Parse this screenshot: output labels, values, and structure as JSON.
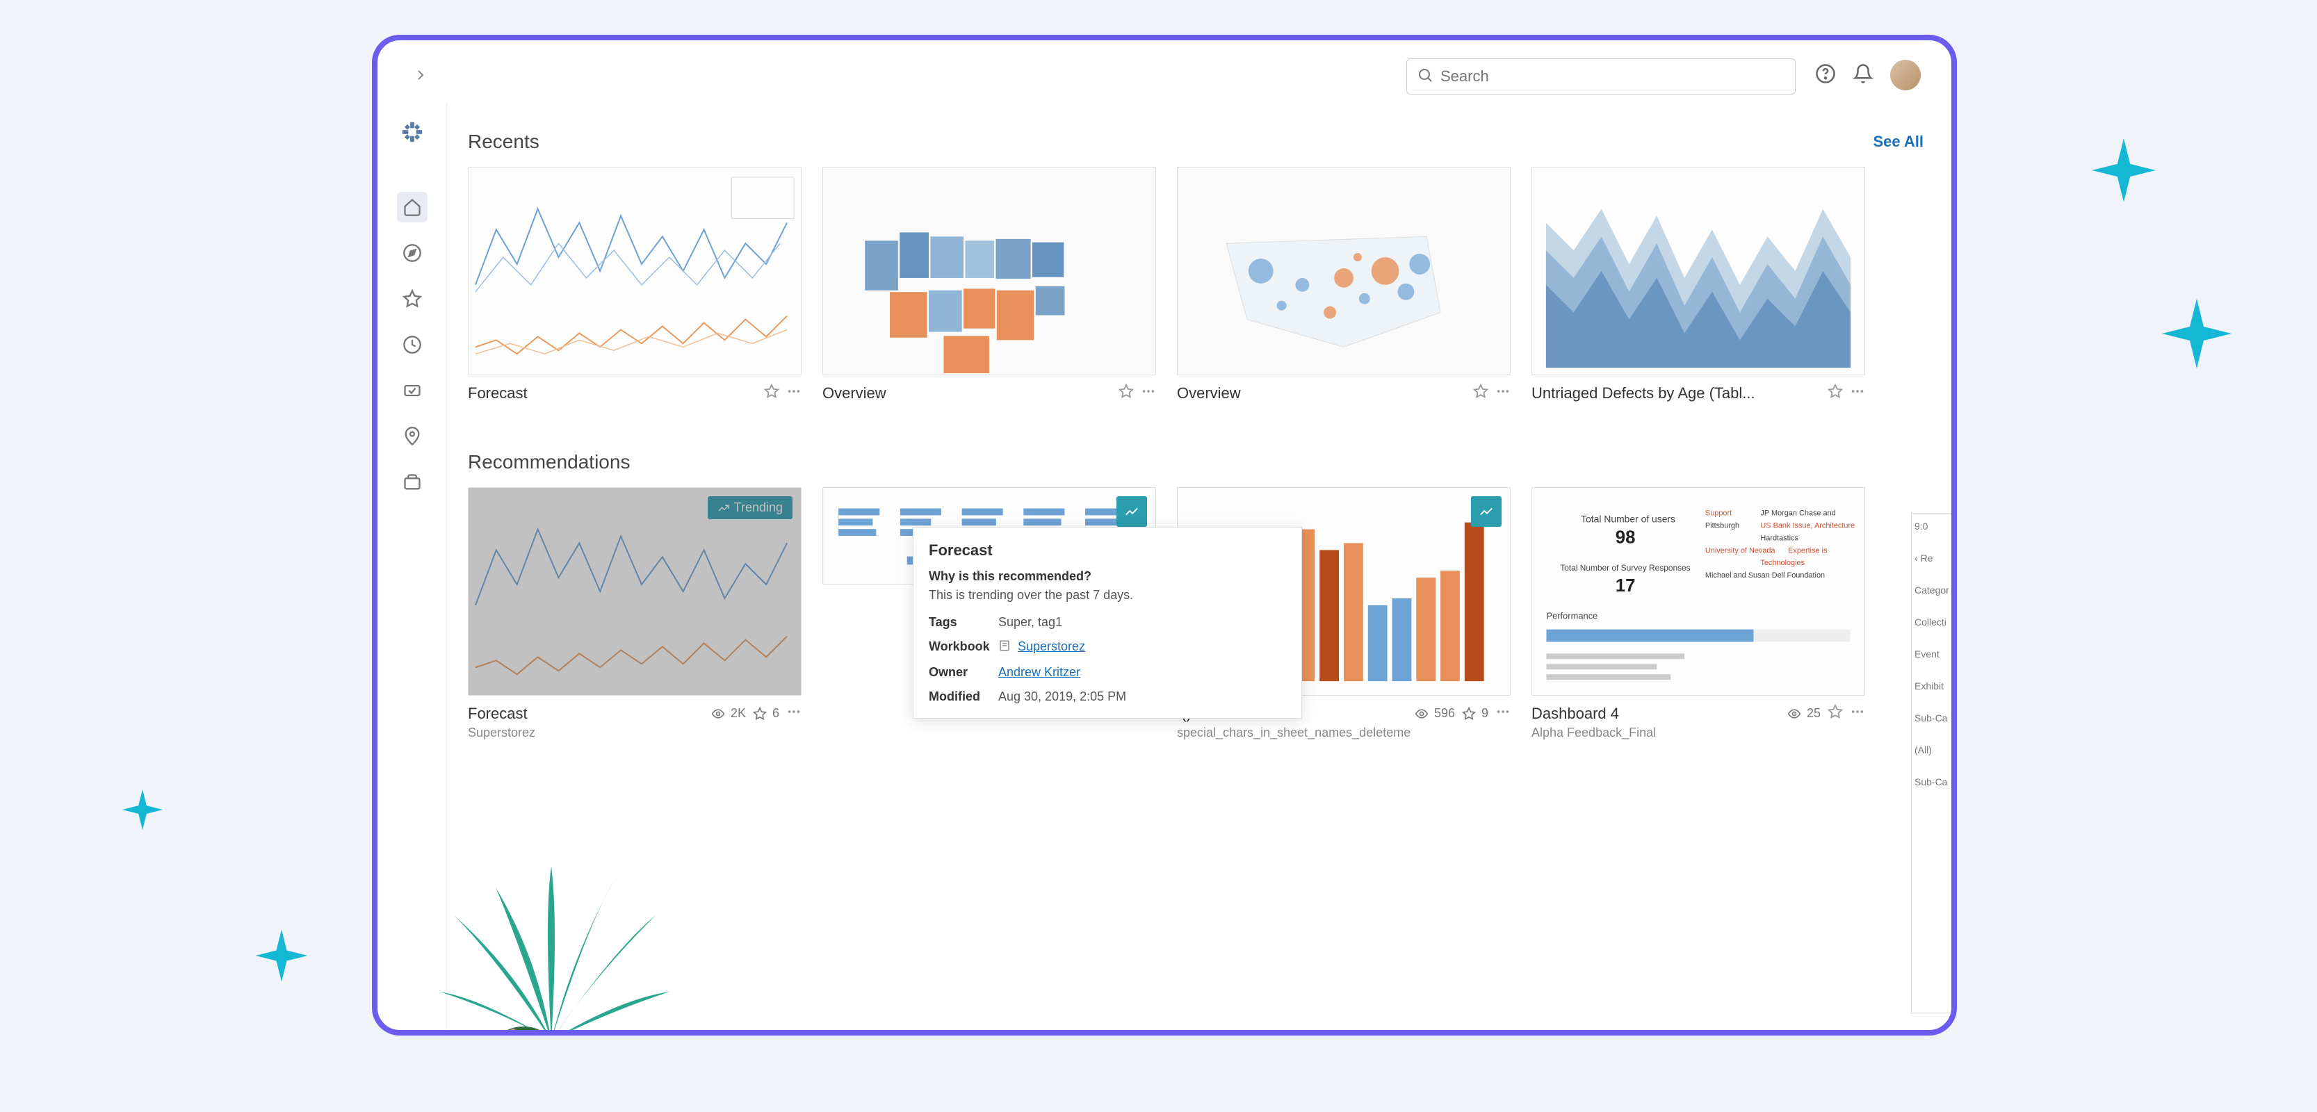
{
  "header": {
    "search_placeholder": "Search"
  },
  "sections": {
    "recents": {
      "title": "Recents",
      "see_all": "See All",
      "cards": [
        {
          "title": "Forecast"
        },
        {
          "title": "Overview"
        },
        {
          "title": "Overview"
        },
        {
          "title": "Untriaged Defects by Age (Tabl..."
        }
      ]
    },
    "recommendations": {
      "title": "Recommendations",
      "trending_badge": "Trending",
      "cards": [
        {
          "title": "Forecast",
          "subtitle": "Superstorez",
          "views": "2K",
          "stars": "6"
        },
        {
          "title": "",
          "subtitle": ""
        },
        {
          "title": "!()!#",
          "subtitle": "special_chars_in_sheet_names_deleteme",
          "views": "596",
          "stars": "9"
        },
        {
          "title": "Dashboard 4",
          "subtitle": "Alpha Feedback_Final",
          "views": "25"
        }
      ]
    }
  },
  "popover": {
    "title": "Forecast",
    "why_label": "Why is this recommended?",
    "why_text": "This is trending over the past 7 days.",
    "tags_label": "Tags",
    "tags_value": "Super, tag1",
    "workbook_label": "Workbook",
    "workbook_value": "Superstorez",
    "owner_label": "Owner",
    "owner_value": "Andrew Kritzer",
    "modified_label": "Modified",
    "modified_value": "Aug 30, 2019, 2:05 PM"
  },
  "sliver": {
    "time": "9:0",
    "back": "Re",
    "l1": "Categor",
    "l2": "Collecti",
    "l3": "Event",
    "l4": "Exhibit",
    "l5": "Sub-Ca",
    "l6": "(All)",
    "l7": "Sub-Ca"
  }
}
